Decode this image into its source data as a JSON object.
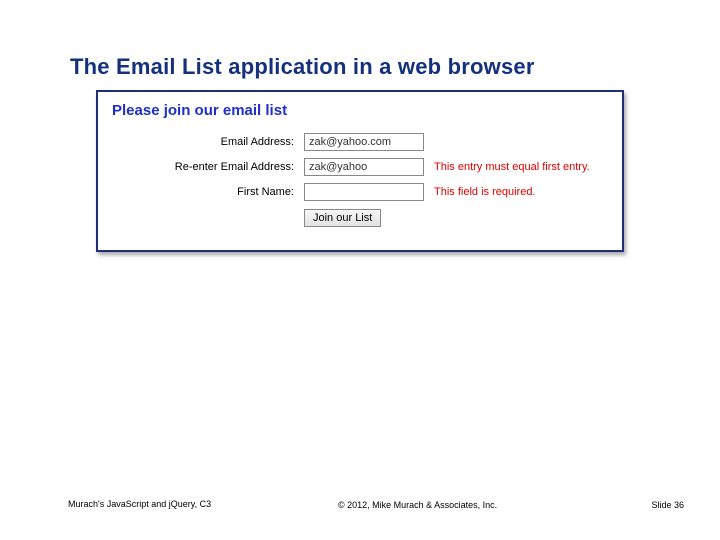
{
  "slide": {
    "title": "The Email List application in a web browser"
  },
  "form": {
    "heading": "Please join our email list",
    "rows": [
      {
        "label": "Email Address:",
        "value": "zak@yahoo.com",
        "error": ""
      },
      {
        "label": "Re-enter Email Address:",
        "value": "zak@yahoo",
        "error": "This entry must equal first entry."
      },
      {
        "label": "First Name:",
        "value": "",
        "error": "This field is required."
      }
    ],
    "submit_label": "Join our List"
  },
  "footer": {
    "left": "Murach's JavaScript and jQuery, C3",
    "center": "© 2012, Mike Murach & Associates, Inc.",
    "right": "Slide 36"
  }
}
